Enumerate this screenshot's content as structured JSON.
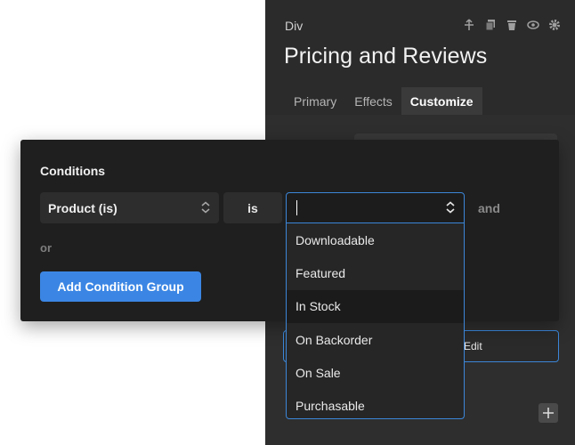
{
  "panel": {
    "element_type": "Div",
    "title": "Pricing and Reviews",
    "tabs": [
      {
        "label": "Primary",
        "active": false
      },
      {
        "label": "Effects",
        "active": false
      },
      {
        "label": "Customize",
        "active": true
      }
    ],
    "icons": [
      "move-icon",
      "duplicate-icon",
      "delete-icon",
      "visibility-icon",
      "settings-icon"
    ],
    "edit_label": "Edit"
  },
  "modal": {
    "title": "Conditions",
    "field_value": "Product (is)",
    "operator_value": "is",
    "value_input": "",
    "and_label": "and",
    "or_label": "or",
    "add_group_label": "Add Condition Group"
  },
  "dropdown": {
    "options": [
      "Downloadable",
      "Featured",
      "In Stock",
      "On Backorder",
      "On Sale",
      "Purchasable"
    ],
    "hovered": "In Stock"
  },
  "colors": {
    "accent": "#3b86e4",
    "panel_bg": "#2b2b2b",
    "modal_bg": "#1f1f1f"
  }
}
